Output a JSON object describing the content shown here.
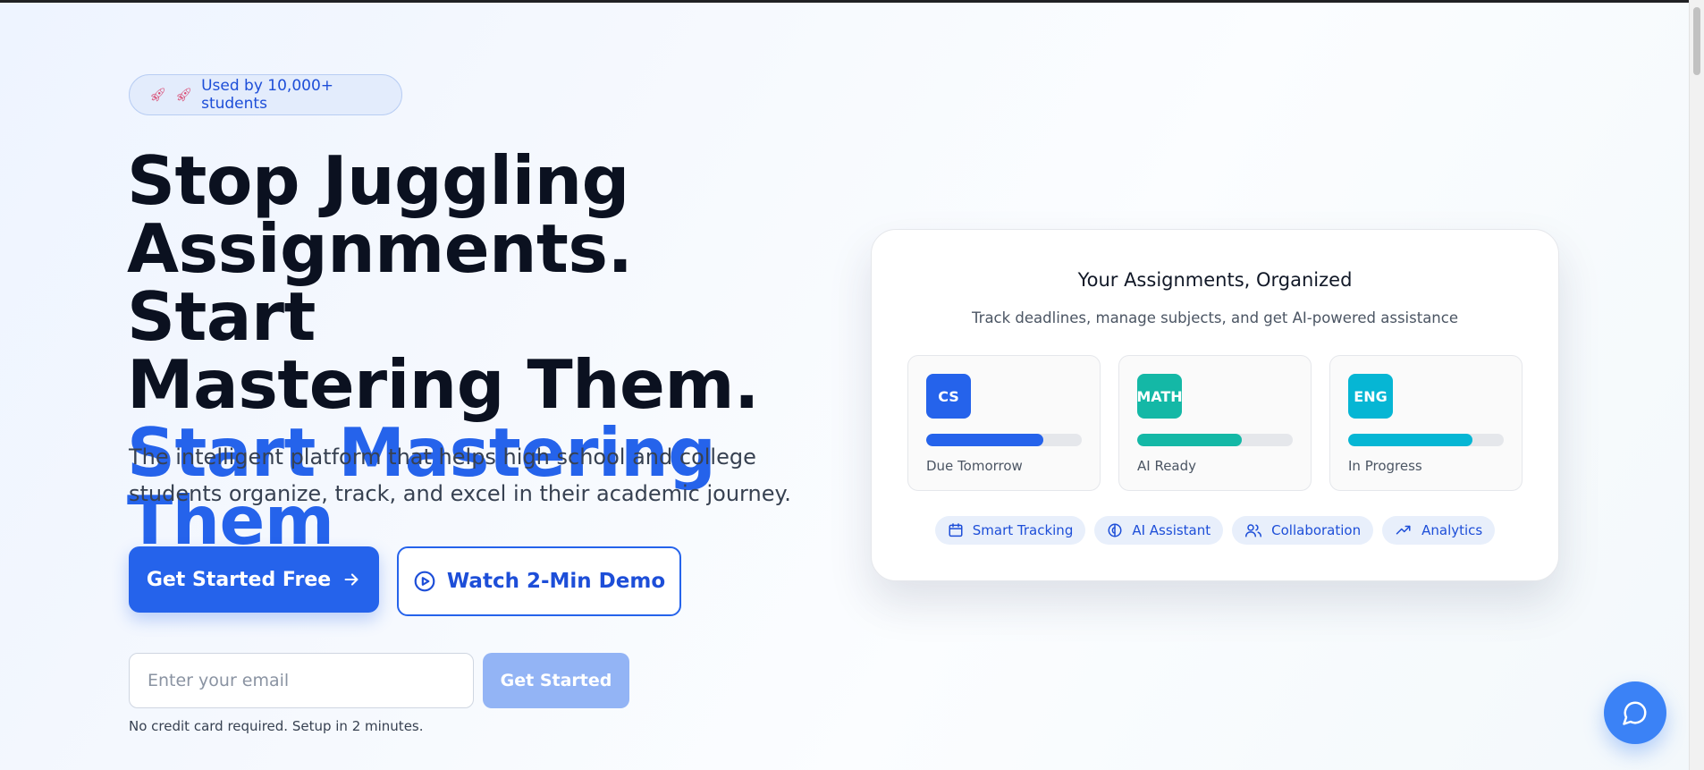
{
  "badge": {
    "icons": [
      "rocket-icon",
      "rocket-icon"
    ],
    "label": "Used by 10,000+ students"
  },
  "hero": {
    "headline_lines": [
      "Stop Juggling",
      "Assignments. Start",
      "Mastering Them."
    ],
    "headline_accent": "Start Mastering Them",
    "subtitle": "The intelligent platform that helps high school and college students organize, track, and excel in their academic journey."
  },
  "cta": {
    "primary_label": "Get Started Free",
    "primary_icon": "arrow-right-icon",
    "demo_label": "Watch 2-Min Demo",
    "demo_icon": "play-circle-icon"
  },
  "signup": {
    "email_placeholder": "Enter your email",
    "email_value": "",
    "button_label": "Get Started",
    "note": "No credit card required. Setup in 2 minutes."
  },
  "preview_card": {
    "title": "Your Assignments, Organized",
    "subtitle": "Track deadlines, manage subjects, and get AI-powered assistance",
    "subjects": [
      {
        "code": "CS",
        "status": "Due Tomorrow",
        "progress": 0.75,
        "color": "#2563eb"
      },
      {
        "code": "MATH",
        "status": "AI Ready",
        "progress": 0.67,
        "color": "#14b8a6"
      },
      {
        "code": "ENG",
        "status": "In Progress",
        "progress": 0.8,
        "color": "#06b6d4"
      }
    ],
    "features": [
      {
        "label": "Smart Tracking",
        "icon": "calendar-icon"
      },
      {
        "label": "AI Assistant",
        "icon": "brain-icon"
      },
      {
        "label": "Collaboration",
        "icon": "users-icon"
      },
      {
        "label": "Analytics",
        "icon": "trending-up-icon"
      }
    ]
  },
  "chat": {
    "icon": "chat-bubble-icon"
  },
  "colors": {
    "accent": "#2563eb",
    "accent_light": "#93b4f5",
    "heading": "#0b1120",
    "chat": "#3b82f6"
  }
}
